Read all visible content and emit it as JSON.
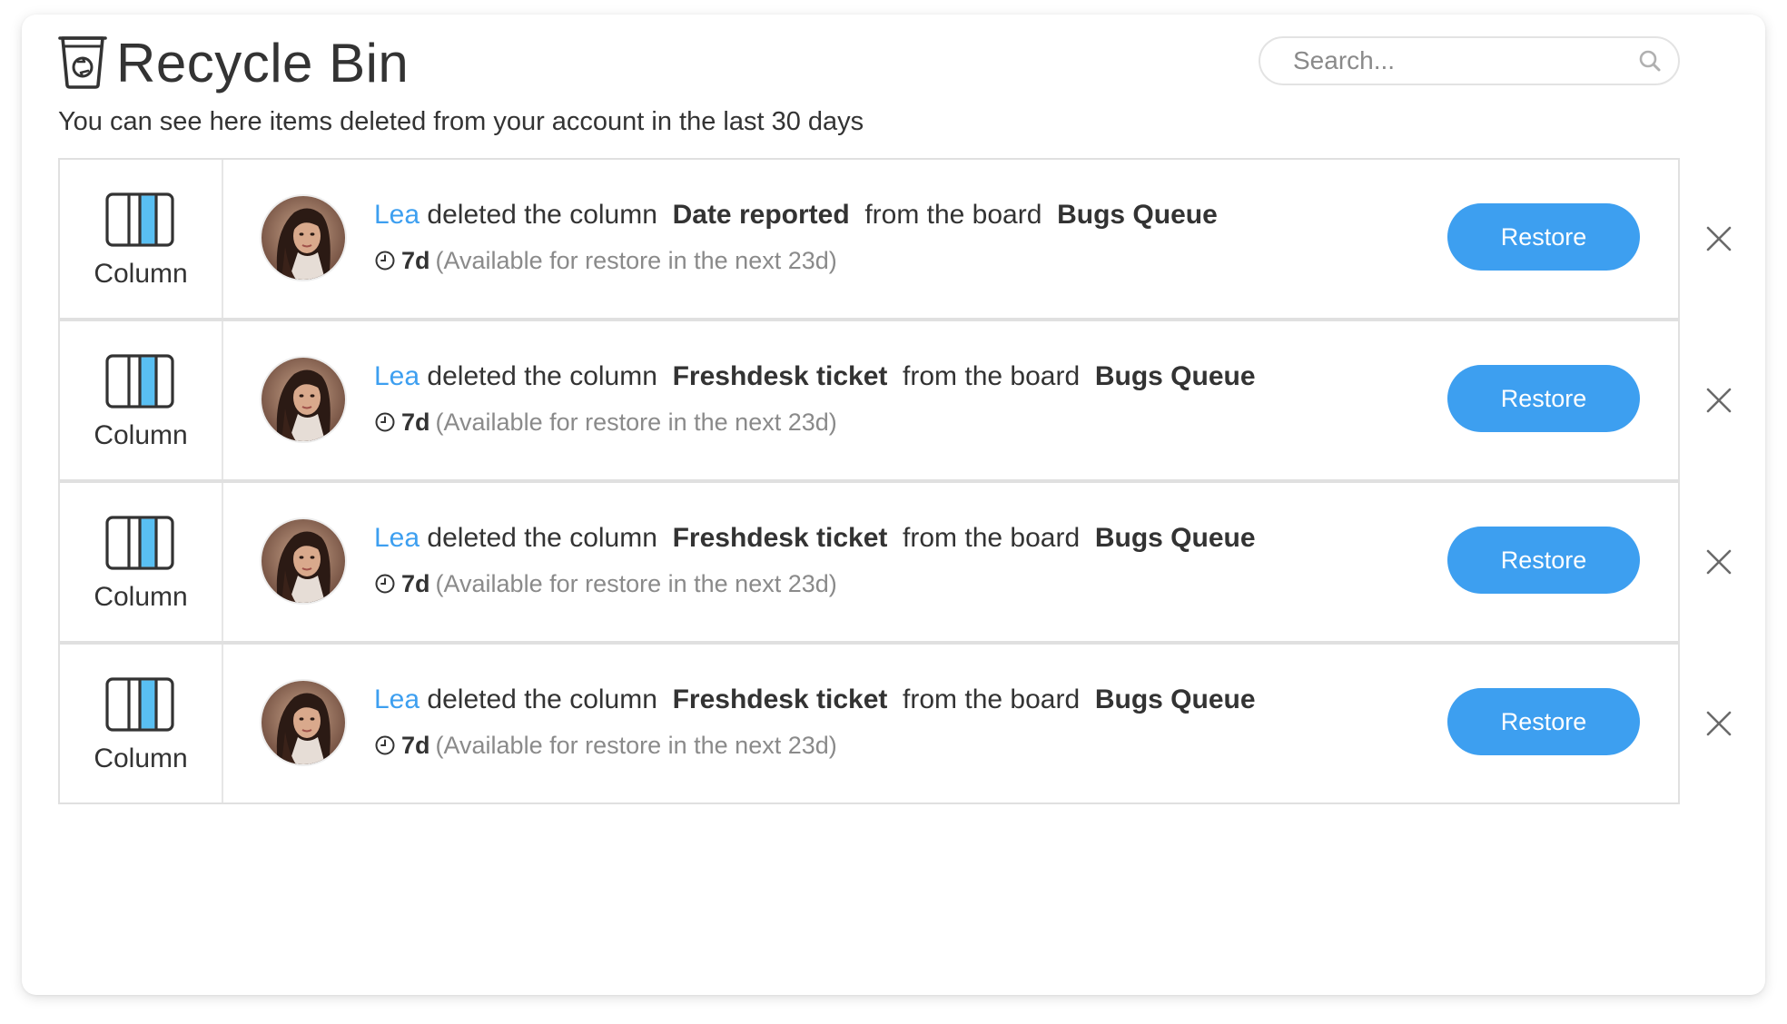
{
  "header": {
    "title": "Recycle Bin",
    "subtitle": "You can see here items deleted from your account in the last 30 days",
    "icon": "recycle-bin-icon"
  },
  "search": {
    "placeholder": "Search...",
    "value": "",
    "icon": "search-icon"
  },
  "colors": {
    "accent": "#3d9ff0",
    "column_icon_fill": "#59bff2",
    "text": "#333333",
    "muted": "#8a8a8a",
    "border": "#e0e0e0"
  },
  "items": [
    {
      "type_label": "Column",
      "type_icon": "column-icon",
      "user": "Lea",
      "action": "deleted the column",
      "item_name": "Date reported",
      "connector": "from the board",
      "board": "Bugs Queue",
      "age": "7d",
      "availability": "(Available for restore in the next 23d)",
      "restore_label": "Restore",
      "dismiss_icon": "close-icon"
    },
    {
      "type_label": "Column",
      "type_icon": "column-icon",
      "user": "Lea",
      "action": "deleted the column",
      "item_name": "Freshdesk ticket",
      "connector": "from the board",
      "board": "Bugs Queue",
      "age": "7d",
      "availability": "(Available for restore in the next 23d)",
      "restore_label": "Restore",
      "dismiss_icon": "close-icon"
    },
    {
      "type_label": "Column",
      "type_icon": "column-icon",
      "user": "Lea",
      "action": "deleted the column",
      "item_name": "Freshdesk ticket",
      "connector": "from the board",
      "board": "Bugs Queue",
      "age": "7d",
      "availability": "(Available for restore in the next 23d)",
      "restore_label": "Restore",
      "dismiss_icon": "close-icon"
    },
    {
      "type_label": "Column",
      "type_icon": "column-icon",
      "user": "Lea",
      "action": "deleted the column",
      "item_name": "Freshdesk ticket",
      "connector": "from the board",
      "board": "Bugs Queue",
      "age": "7d",
      "availability": "(Available for restore in the next 23d)",
      "restore_label": "Restore",
      "dismiss_icon": "close-icon"
    }
  ]
}
